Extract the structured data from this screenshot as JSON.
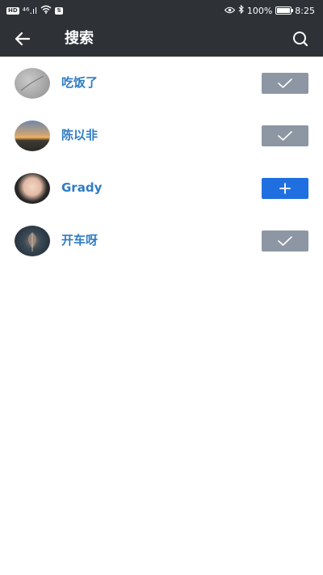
{
  "status_bar": {
    "network_badge": "HD",
    "signal": "⁴⁶.ıl",
    "wifi_icon": "wifi-icon",
    "vpn_badge": "⇅",
    "eye_icon": "eye-icon",
    "bluetooth_icon": "bluetooth-icon",
    "battery_percent": "100%",
    "battery_icon": "battery-icon",
    "time": "8:25"
  },
  "toolbar": {
    "title": "搜索",
    "back_icon": "arrow-left-icon",
    "search_icon": "search-icon"
  },
  "colors": {
    "toolbar_bg": "#2e3237",
    "name_text": "#2f7cc4",
    "added_button": "#8d97a3",
    "add_button": "#1f6fe0"
  },
  "results": [
    {
      "name": "吃饭了",
      "status": "added",
      "action_icon": "check-icon"
    },
    {
      "name": "陈以非",
      "status": "added",
      "action_icon": "check-icon"
    },
    {
      "name": "Grady",
      "status": "not-added",
      "action_icon": "plus-icon"
    },
    {
      "name": "开车呀",
      "status": "added",
      "action_icon": "check-icon"
    }
  ]
}
